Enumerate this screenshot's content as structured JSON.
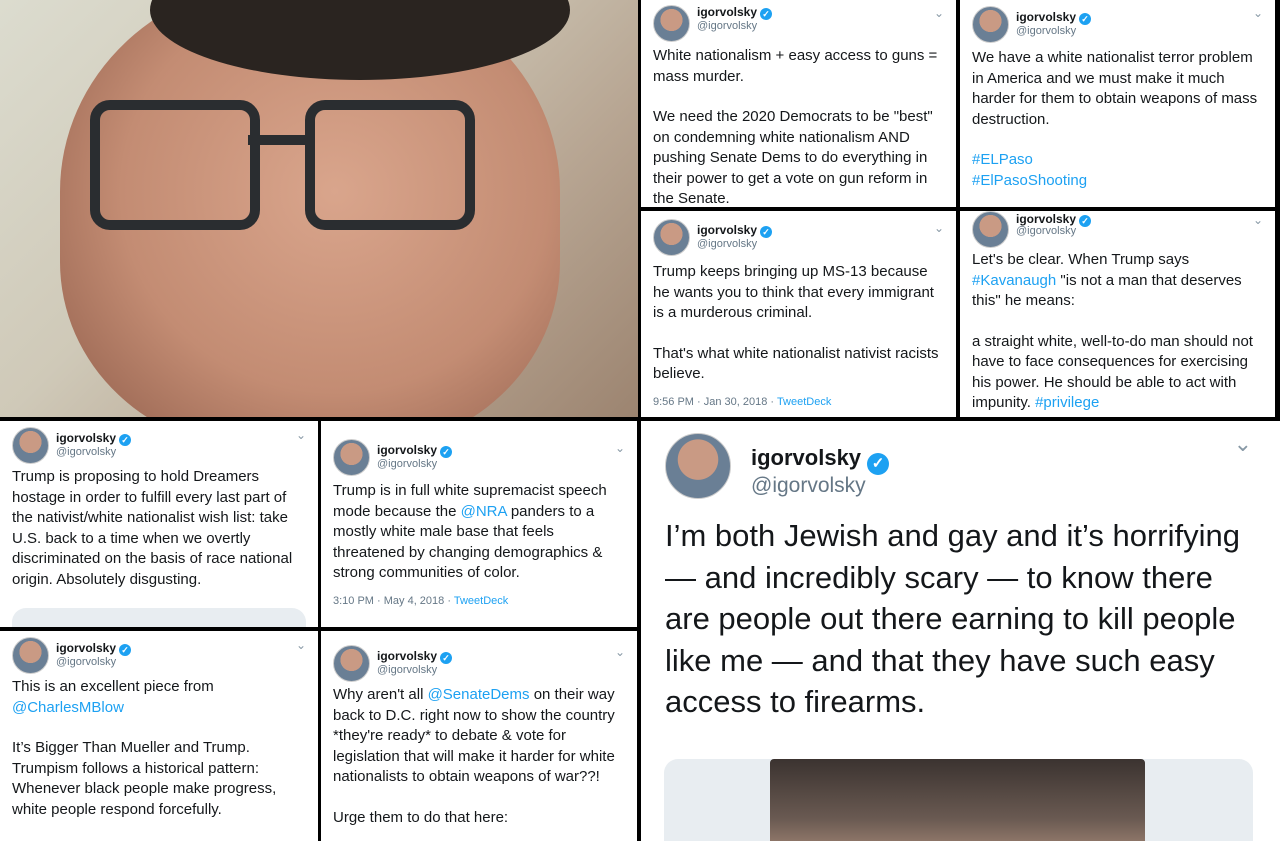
{
  "tweets": {
    "t1": {
      "name": "igorvolsky",
      "handle": "@igorvolsky",
      "paras": [
        "White nationalism + easy access to guns = mass murder.",
        "We need the 2020 Democrats to be \"best\" on condemning white nationalism AND pushing Senate Dems to do everything in their power to get a vote on gun reform in the Senate."
      ]
    },
    "t2": {
      "name": "igorvolsky",
      "handle": "@igorvolsky",
      "p1": "We have a white nationalist terror problem in America and we must make it much harder for them to obtain weapons of mass destruction.",
      "tag1": "#ELPaso",
      "tag2": "#ElPasoShooting"
    },
    "t3": {
      "name": "igorvolsky",
      "handle": "@igorvolsky",
      "paras": [
        "Trump keeps bringing up MS-13 because he wants you to think that every immigrant is a murderous criminal.",
        "That's what white nationalist nativist racists believe."
      ],
      "time": "9:56 PM · Jan 30, 2018 · ",
      "source": "TweetDeck"
    },
    "t4": {
      "name": "igorvolsky",
      "handle": "@igorvolsky",
      "a": "Let's be clear. When Trump says ",
      "tag": "#Kavanaugh",
      " b": "",
      "b": " \"is not a man that deserves this\" he means:",
      "c": "a straight white, well-to-do man should not have to face consequences for exercising his power. He should be able to act with impunity. ",
      "tag2": "#privilege"
    },
    "t5": {
      "name": "igorvolsky",
      "handle": "@igorvolsky",
      "text": "Trump is proposing to hold Dreamers hostage in order to fulfill every last part of the nativist/white nationalist wish list: take U.S. back to a time when we overtly discriminated on the basis of race national origin. Absolutely disgusting."
    },
    "t6": {
      "name": "igorvolsky",
      "handle": "@igorvolsky",
      "a": "Trump is in full white supremacist speech mode because the ",
      "mention": "@NRA",
      "b": " panders to a mostly white male base that feels threatened by changing demographics & strong communities of color.",
      "time": "3:10 PM · May 4, 2018 · ",
      "source": "TweetDeck"
    },
    "t7": {
      "name": "igorvolsky",
      "handle": "@igorvolsky",
      "a": "This is an excellent piece from ",
      "mention": "@CharlesMBlow",
      "b": "It’s Bigger Than Mueller and Trump. Trumpism follows a historical pattern: Whenever black people make progress, white people respond forcefully."
    },
    "t8": {
      "name": "igorvolsky",
      "handle": "@igorvolsky",
      "a": "Why aren't all ",
      "mention": "@SenateDems",
      "b": " on their way back to D.C. right now to show the country *they're ready* to debate & vote for legislation that will make it harder for white nationalists to obtain weapons of war??!",
      "c": "Urge them to do that here:"
    },
    "t9": {
      "name": "igorvolsky",
      "handle": "@igorvolsky",
      "text": "I’m both Jewish and gay and it’s horrifying — and incredibly scary — to know there are people out there earning to kill people like me — and that they have such easy access to firearms."
    }
  },
  "icons": {
    "verified": "✓",
    "chevron": "⌄"
  }
}
